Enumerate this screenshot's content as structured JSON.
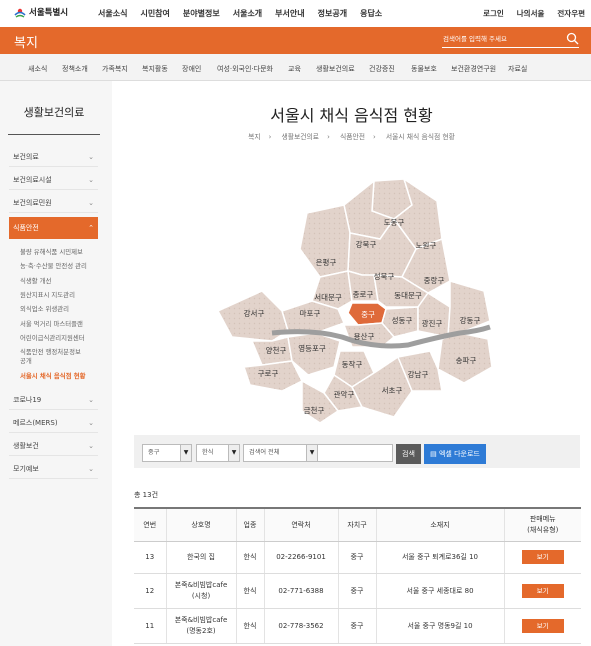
{
  "header": {
    "logo_text": "서울특별시",
    "gnb": [
      "서울소식",
      "시민참여",
      "분야별정보",
      "서울소개",
      "부서안내",
      "정보공개",
      "응답소"
    ],
    "util": [
      "로그인",
      "나의서울",
      "전자우편"
    ]
  },
  "bar": {
    "title": "복지",
    "search_placeholder": "검색어를 입력해 주세요"
  },
  "subnav": [
    "새소식",
    "정책소개",
    "가족복지",
    "복지활동",
    "장애인",
    "여성·외국인·다문화",
    "교육",
    "생활보건의료",
    "건강증진",
    "동물보호",
    "보건환경연구원",
    "자료실"
  ],
  "sidebar": {
    "title": "생활보건의료",
    "items": [
      "보건의료",
      "보건의료시설",
      "보건의료민원",
      "식품안전",
      "코로나19",
      "메르스(MERS)",
      "생활보건",
      "모기예보"
    ],
    "subitems": [
      "불량 유해식품 시민제보",
      "농·축·수산물 안전성 관리",
      "식생활 개선",
      "원산지표시 지도관리",
      "외식업소 위생관리",
      "서울 먹거리 마스터플랜",
      "어린이급식관리지원센터",
      "식품안전 행정처분정보",
      "공개",
      "서울시 채식 음식점 현황"
    ]
  },
  "page": {
    "title": "서울시 채식 음식점 현황",
    "breadcrumb": [
      "복지",
      "생활보건의료",
      "식품안전",
      "서울시 채식 음식점 현황"
    ],
    "breadcrumb_sep": "›"
  },
  "map": {
    "districts": [
      "도봉구",
      "강북구",
      "노원구",
      "은평구",
      "성북구",
      "중랑구",
      "서대문구",
      "종로구",
      "동대문구",
      "마포구",
      "중구",
      "성동구",
      "광진구",
      "강동구",
      "강서구",
      "용산구",
      "양천구",
      "영등포구",
      "동작구",
      "송파구",
      "구로구",
      "관악구",
      "서초구",
      "강남구",
      "금천구"
    ],
    "selected": "중구",
    "colors": {
      "base": "#e2d3cb",
      "selected": "#df6a3a",
      "river": "#9e9e9e"
    }
  },
  "filters": {
    "district": "중구",
    "category": "한식",
    "search_type": "검색어 전체",
    "keyword": "",
    "search_label": "검색",
    "excel_label": "엑셀 다운로드"
  },
  "total": "총 13건",
  "table": {
    "headers": [
      "연번",
      "상호명",
      "업종",
      "연락처",
      "자치구",
      "소재지",
      "판매메뉴\n(채식유형)"
    ],
    "rows": [
      {
        "no": "13",
        "name": "한국의 집",
        "type": "한식",
        "tel": "02-2266-9101",
        "gu": "중구",
        "addr": "서울 중구 퇴계로36길 10",
        "btn": "보기"
      },
      {
        "no": "12",
        "name": "본죽&비빔밥cafe\n(시청)",
        "type": "한식",
        "tel": "02-771-6388",
        "gu": "중구",
        "addr": "서울 중구 세종대로 80",
        "btn": "보기"
      },
      {
        "no": "11",
        "name": "본죽&비빔밥cafe\n(명동2호)",
        "type": "한식",
        "tel": "02-778-3562",
        "gu": "중구",
        "addr": "서울 중구 명동9길 10",
        "btn": "보기"
      }
    ]
  },
  "colors": {
    "accent": "#e4692b",
    "excel": "#2e7bd6"
  }
}
